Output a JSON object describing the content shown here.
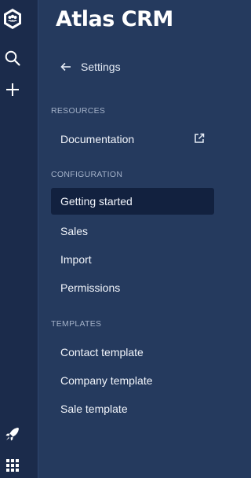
{
  "app": {
    "title": "Atlas CRM"
  },
  "rail": {
    "icons": [
      "app-logo-icon",
      "search-icon",
      "plus-icon",
      "rocket-icon",
      "apps-grid-icon"
    ]
  },
  "nav": {
    "back_label": "Settings",
    "sections": [
      {
        "title": "RESOURCES",
        "items": [
          {
            "label": "Documentation",
            "external": true
          }
        ]
      },
      {
        "title": "CONFIGURATION",
        "items": [
          {
            "label": "Getting started",
            "active": true
          },
          {
            "label": "Sales"
          },
          {
            "label": "Import"
          },
          {
            "label": "Permissions"
          }
        ]
      },
      {
        "title": "TEMPLATES",
        "items": [
          {
            "label": "Contact template"
          },
          {
            "label": "Company template"
          },
          {
            "label": "Sale template"
          }
        ]
      }
    ]
  },
  "colors": {
    "rail_bg": "#1b2b4b",
    "panel_bg": "#253a5e",
    "active_item_bg": "#12213f",
    "text": "#f2f5fb",
    "section_text": "#a3b1c8"
  }
}
